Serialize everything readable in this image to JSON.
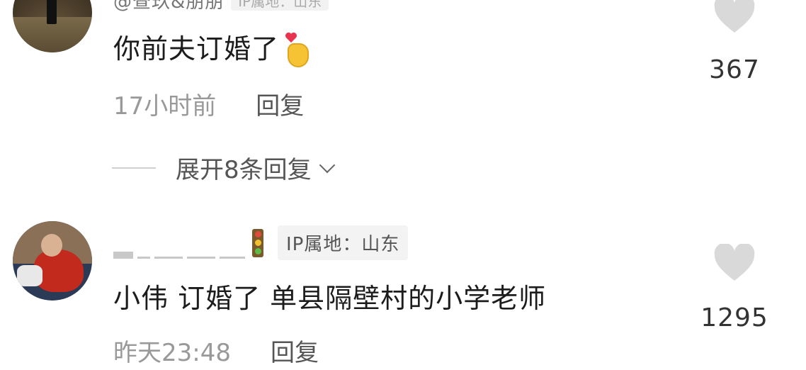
{
  "comments": [
    {
      "username_partial": "@查玖&朋朋",
      "ip_partial": "IP属地：山东",
      "text": "你前夫订婚了",
      "emoji": "finger-heart",
      "time": "17小时前",
      "reply_label": "回复",
      "likes": "367",
      "expand_label": "展开8条回复"
    },
    {
      "ip_location": "IP属地：山东",
      "text": "小伟 订婚了 单县隔壁村的小学老师",
      "time": "昨天23:48",
      "reply_label": "回复",
      "likes": "1295"
    }
  ],
  "icons": {
    "like": "heart-icon",
    "expand": "chevron-down-icon",
    "badge": "traffic-light-icon"
  },
  "colors": {
    "heart_gray": "#d9d9d9",
    "text_primary": "#1c1c1c",
    "text_meta": "#999999",
    "emoji_heart": "#e8344f",
    "emoji_hand": "#f5c333"
  }
}
